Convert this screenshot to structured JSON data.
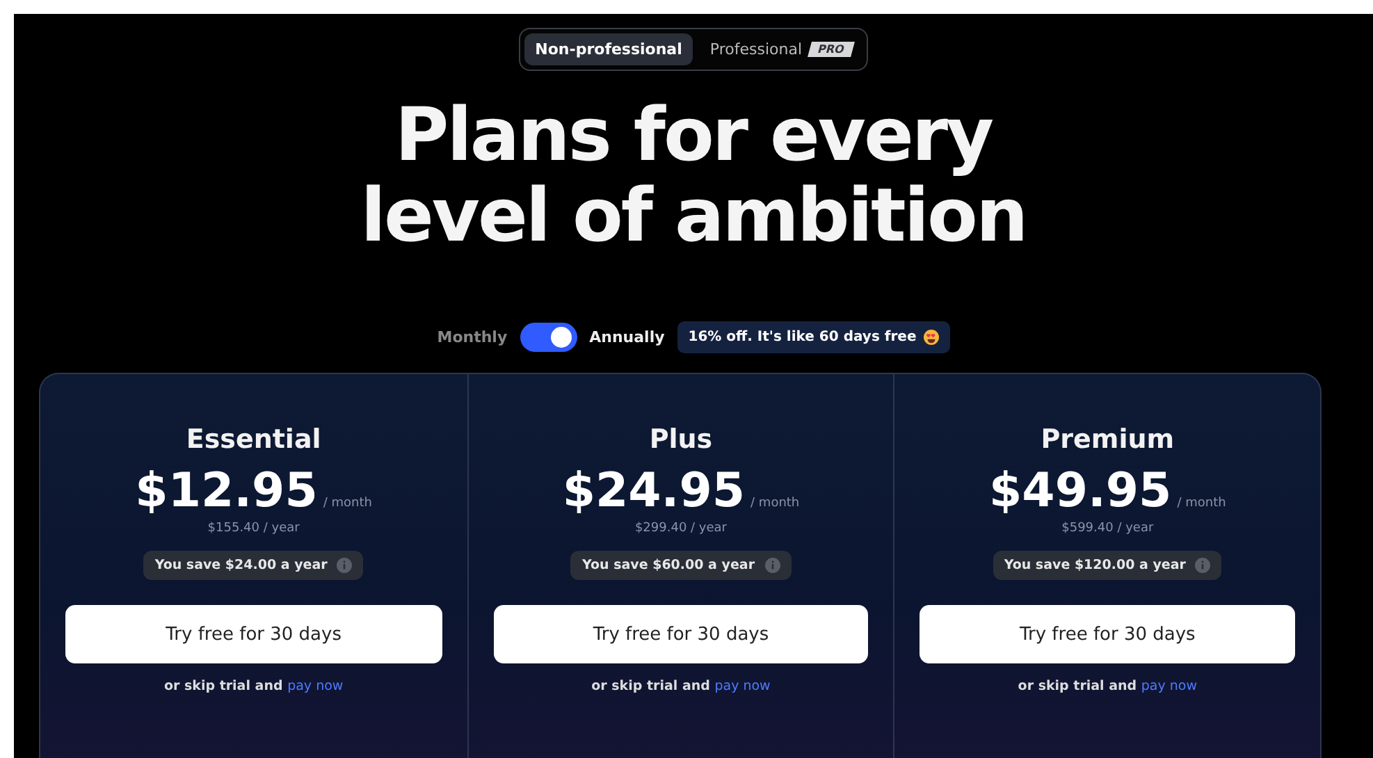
{
  "segments": [
    {
      "label": "Non-professional",
      "selected": true
    },
    {
      "label": "Professional",
      "selected": false,
      "badge": "PRO"
    }
  ],
  "heading": "Plans for every level of ambition",
  "billing": {
    "left_label": "Monthly",
    "right_label": "Annually",
    "on": true,
    "promo": "16% off. It's like 60 days free"
  },
  "plans": [
    {
      "name": "Essential",
      "price": "$12.95",
      "period": "/ month",
      "yearly": "$155.40 / year",
      "savings": "You save $24.00 a year",
      "cta": "Try free for 30 days",
      "skip_text": "or skip trial and",
      "skip_link": "pay now"
    },
    {
      "name": "Plus",
      "price": "$24.95",
      "period": "/ month",
      "yearly": "$299.40 / year",
      "savings": "You save $60.00 a year",
      "cta": "Try free for 30 days",
      "skip_text": "or skip trial and",
      "skip_link": "pay now"
    },
    {
      "name": "Premium",
      "price": "$49.95",
      "period": "/ month",
      "yearly": "$599.40 / year",
      "savings": "You save $120.00 a year",
      "cta": "Try free for 30 days",
      "skip_text": "or skip trial and",
      "skip_link": "pay now"
    }
  ]
}
